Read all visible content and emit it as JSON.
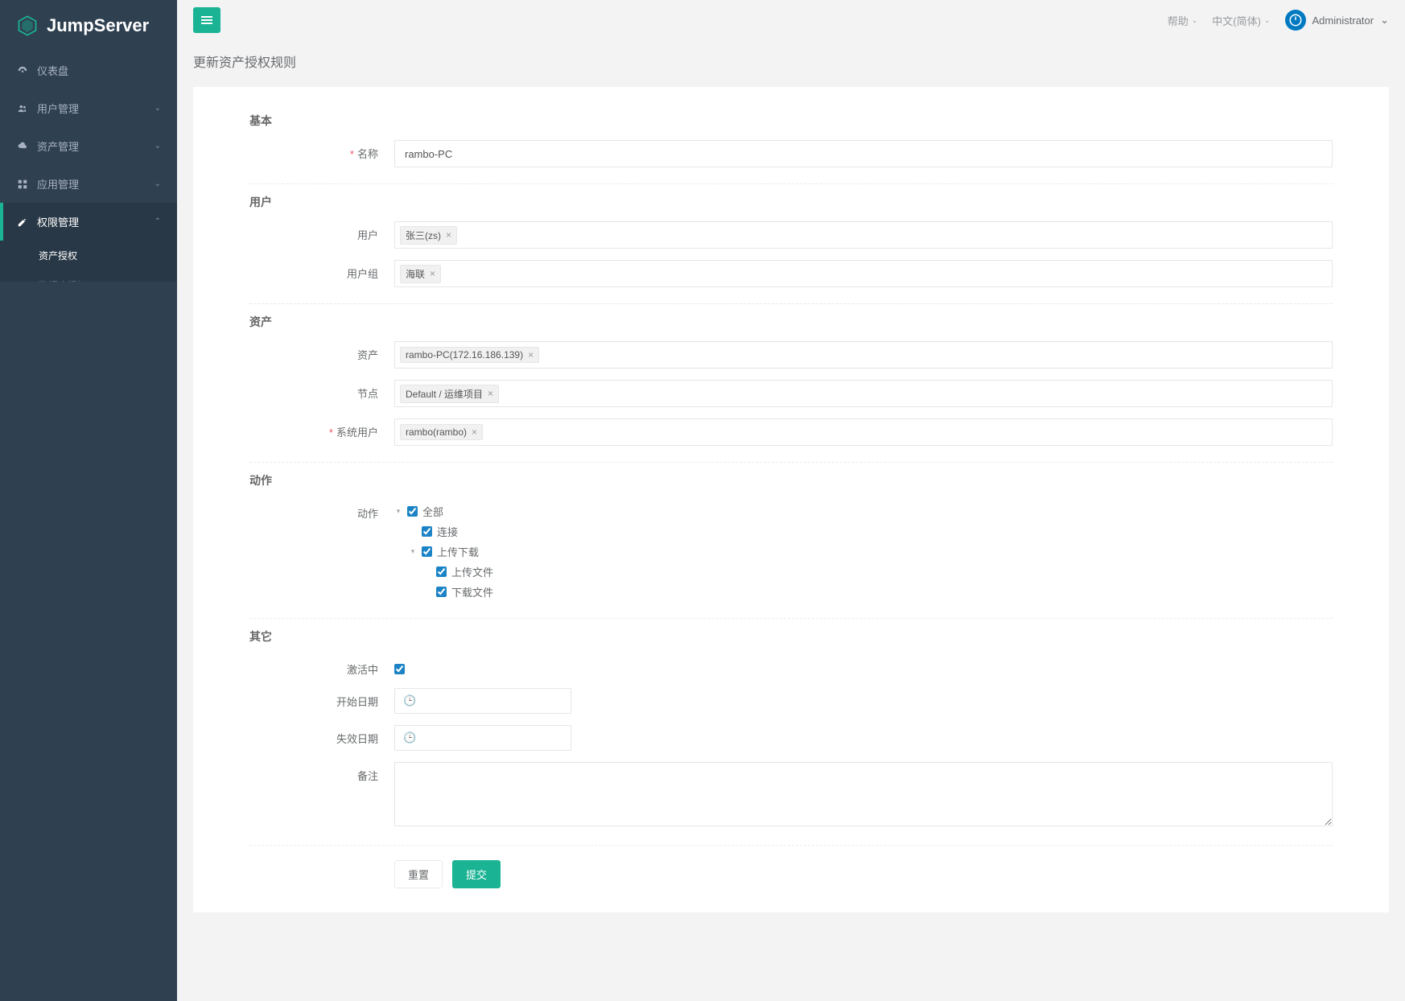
{
  "brand": "JumpServer",
  "topbar": {
    "help": "帮助",
    "lang": "中文(简体)",
    "user": "Administrator"
  },
  "sidebar": {
    "items": [
      {
        "label": "仪表盘",
        "icon": "dashboard"
      },
      {
        "label": "用户管理",
        "icon": "users",
        "expandable": true
      },
      {
        "label": "资产管理",
        "icon": "cloud",
        "expandable": true
      },
      {
        "label": "应用管理",
        "icon": "grid",
        "expandable": true
      },
      {
        "label": "权限管理",
        "icon": "edit",
        "expandable": true,
        "active": true
      }
    ],
    "sub": [
      {
        "label": "资产授权",
        "active": true
      },
      {
        "label": "数据库授权",
        "active": false
      }
    ]
  },
  "page_title": "更新资产授权规则",
  "sections": {
    "basic": {
      "title": "基本",
      "name_label": "名称",
      "name_value": "rambo-PC"
    },
    "user": {
      "title": "用户",
      "user_label": "用户",
      "user_tags": [
        "张三(zs)"
      ],
      "group_label": "用户组",
      "group_tags": [
        "海联"
      ]
    },
    "asset": {
      "title": "资产",
      "asset_label": "资产",
      "asset_tags": [
        "rambo-PC(172.16.186.139)"
      ],
      "node_label": "节点",
      "node_tags": [
        "Default / 运维项目"
      ],
      "sysuser_label": "系统用户",
      "sysuser_tags": [
        "rambo(rambo)"
      ]
    },
    "action": {
      "title": "动作",
      "action_label": "动作",
      "tree": {
        "all": "全部",
        "connect": "连接",
        "updown": "上传下载",
        "upload": "上传文件",
        "download": "下载文件"
      }
    },
    "other": {
      "title": "其它",
      "active_label": "激活中",
      "start_label": "开始日期",
      "expire_label": "失效日期",
      "comment_label": "备注"
    }
  },
  "buttons": {
    "reset": "重置",
    "submit": "提交"
  }
}
